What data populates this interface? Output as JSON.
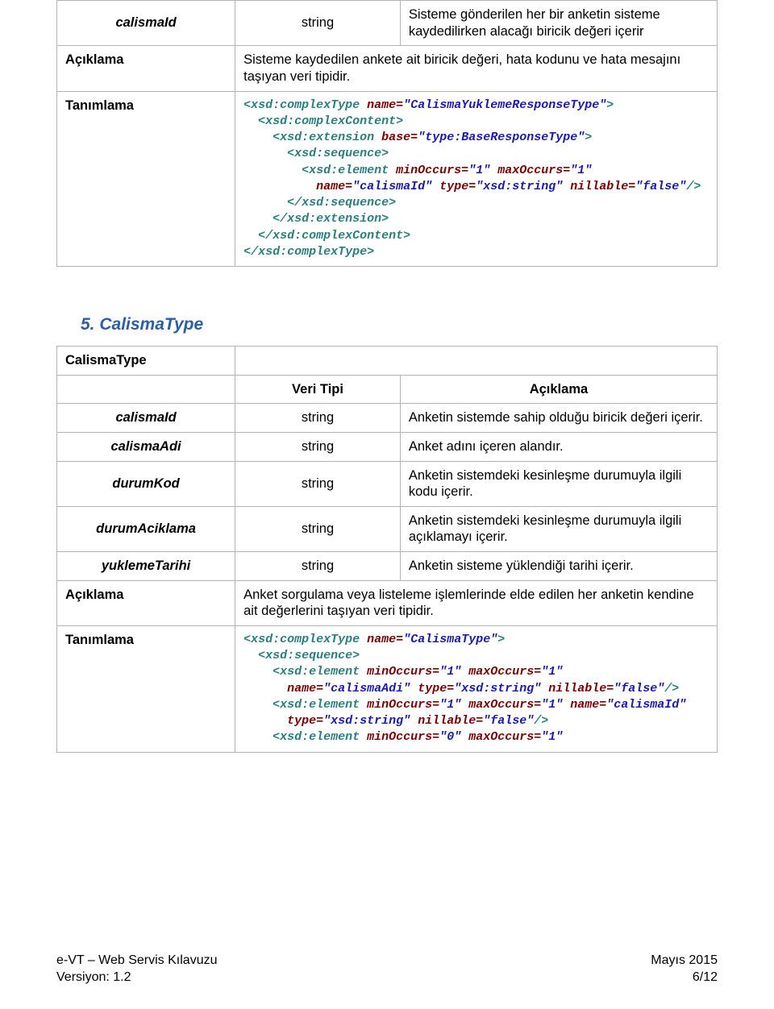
{
  "table1": {
    "col1_w": "27%",
    "col2_w": "25%",
    "rows": [
      {
        "c1": "calismaId",
        "c1_class": "bi center",
        "c2": "string",
        "c2_class": "center",
        "c3": "Sisteme gönderilen her bir anketin sisteme kaydedilirken alacağı biricik değeri içerir"
      }
    ],
    "aciklama_label": "Açıklama",
    "aciklama_text": "Sisteme kaydedilen ankete ait biricik değeri, hata kodunu ve hata mesajını taşıyan veri tipidir.",
    "tanimlama_label": "Tanımlama"
  },
  "code1": {
    "l1a": "<xsd:complexType",
    "l1b": " name",
    "l1c": "=",
    "l1d": "\"CalismaYuklemeResponseType\"",
    "l1e": ">",
    "l2": "  <xsd:complexContent>",
    "l3a": "    <xsd:extension",
    "l3b": " base",
    "l3c": "=",
    "l3d": "\"type:BaseResponseType\"",
    "l3e": ">",
    "l4": "      <xsd:sequence>",
    "l5a": "        <xsd:element",
    "l5b": " minOccurs",
    "l5c": "=",
    "l5d": "\"1\"",
    "l5e": " maxOccurs",
    "l5f": "=",
    "l5g": "\"1\"",
    "l6a": "          name",
    "l6b": "=",
    "l6c": "\"calismaId\"",
    "l6d": " type",
    "l6e": "=",
    "l6f": "\"xsd:string\"",
    "l6g": " nillable",
    "l6h": "=",
    "l6i": "\"false\"",
    "l6j": "/>",
    "l7": "      </xsd:sequence>",
    "l8": "    </xsd:extension>",
    "l9": "  </xsd:complexContent>",
    "l10": "</xsd:complexType>"
  },
  "section2": {
    "number": "5.",
    "title": "CalismaType"
  },
  "table2": {
    "header_type": "CalismaType",
    "col1_w": "27%",
    "col2_w": "25%",
    "hdr_veri": "Veri Tipi",
    "hdr_acik": "Açıklama",
    "rows": [
      {
        "c1": "calismaId",
        "c2": "string",
        "c3": "Anketin sistemde sahip olduğu biricik değeri içerir."
      },
      {
        "c1": "calismaAdi",
        "c2": "string",
        "c3": "Anket adını içeren alandır."
      },
      {
        "c1": "durumKod",
        "c2": "string",
        "c3": "Anketin sistemdeki kesinleşme durumuyla ilgili kodu içerir."
      },
      {
        "c1": "durumAciklama",
        "c2": "string",
        "c3": "Anketin sistemdeki kesinleşme durumuyla ilgili açıklamayı içerir."
      },
      {
        "c1": "yuklemeTarihi",
        "c2": "string",
        "c3": "Anketin sisteme yüklendiği tarihi içerir."
      }
    ],
    "aciklama_label": "Açıklama",
    "aciklama_text": "Anket sorgulama veya listeleme işlemlerinde elde edilen her anketin kendine ait değerlerini taşıyan veri tipidir.",
    "tanimlama_label": "Tanımlama"
  },
  "code2": {
    "l1a": "<xsd:complexType",
    "l1b": " name",
    "l1c": "=",
    "l1d": "\"CalismaType\"",
    "l1e": ">",
    "l2": "  <xsd:sequence>",
    "l3a": "    <xsd:element",
    "l3b": " minOccurs",
    "l3c": "=",
    "l3d": "\"1\"",
    "l3e": " maxOccurs",
    "l3f": "=",
    "l3g": "\"1\"",
    "l4a": "      name",
    "l4b": "=",
    "l4c": "\"calismaAdi\"",
    "l4d": " type",
    "l4e": "=",
    "l4f": "\"xsd:string\"",
    "l4g": " nillable",
    "l4h": "=",
    "l4i": "\"false\"",
    "l4j": "/>",
    "l5a": "    <xsd:element",
    "l5b": " minOccurs",
    "l5c": "=",
    "l5d": "\"1\"",
    "l5e": " maxOccurs",
    "l5f": "=",
    "l5g": "\"1\"",
    "l5h": " name",
    "l5i": "=",
    "l5j": "\"calismaId\"",
    "l6a": "      type",
    "l6b": "=",
    "l6c": "\"xsd:string\"",
    "l6d": " nillable",
    "l6e": "=",
    "l6f": "\"false\"",
    "l6g": "/>",
    "l7a": "    <xsd:element",
    "l7b": " minOccurs",
    "l7c": "=",
    "l7d": "\"0\"",
    "l7e": " maxOccurs",
    "l7f": "=",
    "l7g": "\"1\""
  },
  "footer": {
    "left1": "e-VT – Web Servis Kılavuzu",
    "left2": "Versiyon: 1.2",
    "right1": "Mayıs 2015",
    "right2": "6/12"
  }
}
